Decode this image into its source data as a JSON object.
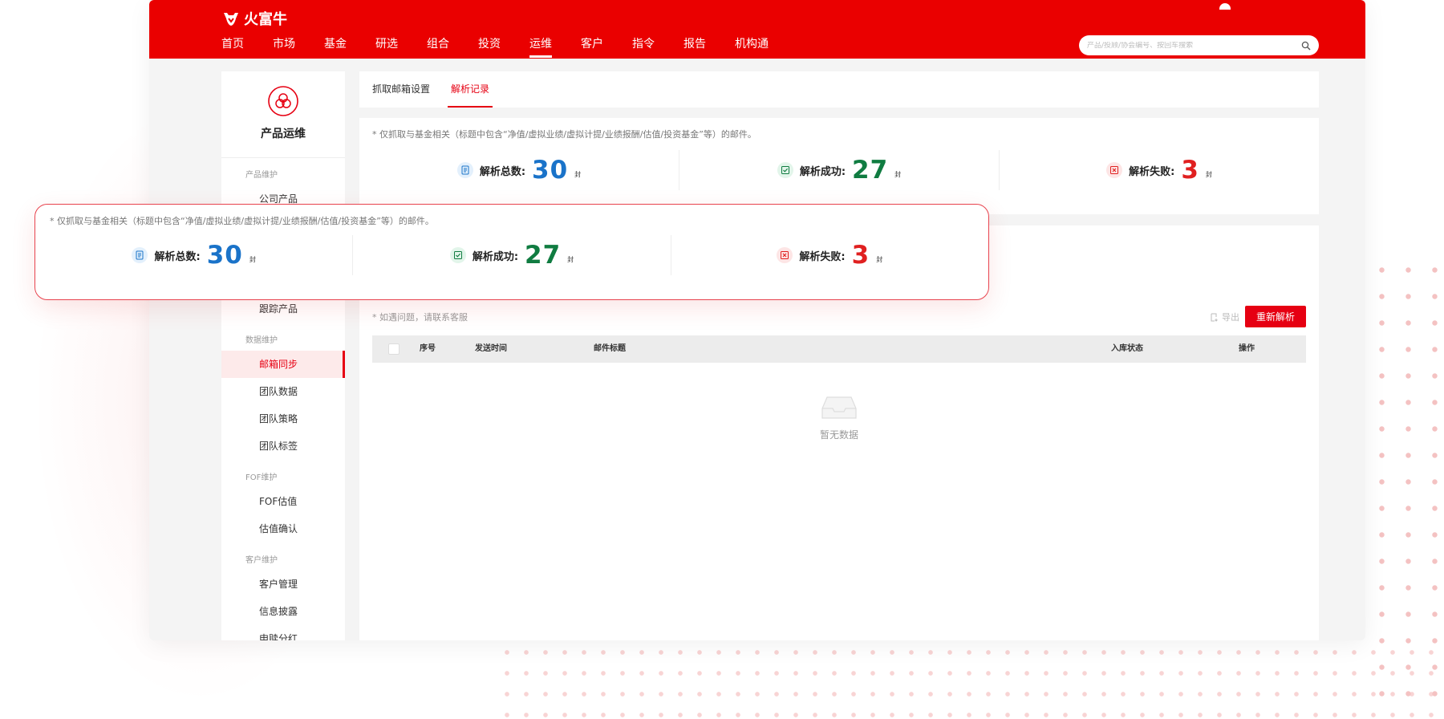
{
  "brand": {
    "name": "火富牛",
    "accent": "#e60012"
  },
  "nav": {
    "items": [
      "首页",
      "市场",
      "基金",
      "研选",
      "组合",
      "投资",
      "运维",
      "客户",
      "指令",
      "报告",
      "机构通"
    ],
    "active": "运维"
  },
  "search": {
    "placeholder": "产品/投顾/协会编号、按回车搜索"
  },
  "sidebar": {
    "title": "产品运维",
    "groups": {
      "product": "产品维护",
      "data": "数据维护",
      "fof": "FOF维护",
      "customer": "客户维护"
    },
    "items": {
      "company_product": "公司产品",
      "track_product": "跟踪产品",
      "email_sync": "邮箱同步",
      "team_data": "团队数据",
      "team_strategy": "团队策略",
      "team_tags": "团队标签",
      "fof_valuation": "FOF估值",
      "valuation_confirm": "估值确认",
      "customer_mgmt": "客户管理",
      "disclosure": "信息披露",
      "dividend": "申赎分红"
    },
    "active": "邮箱同步"
  },
  "tabs": {
    "fetch_settings": "抓取邮箱设置",
    "parse_records": "解析记录",
    "active": "解析记录"
  },
  "stats": {
    "note": "* 仅抓取与基金相关（标题中包含“净值/虚拟业绩/虚拟计提/业绩报酬/估值/投资基金”等）的邮件。",
    "unit": "封",
    "total": {
      "label": "解析总数:",
      "value": "30",
      "color": "#1a73c9"
    },
    "success": {
      "label": "解析成功:",
      "value": "27",
      "color": "#107c41"
    },
    "failed": {
      "label": "解析失败:",
      "value": "3",
      "color": "#e02020"
    }
  },
  "table": {
    "note": "* 如遇问题，请联系客服",
    "export_label": "导出",
    "reparse_button": "重新解析",
    "columns": {
      "seq": "序号",
      "send_time": "发送时间",
      "subject": "邮件标题",
      "status": "入库状态",
      "action": "操作"
    },
    "empty": "暂无数据"
  }
}
